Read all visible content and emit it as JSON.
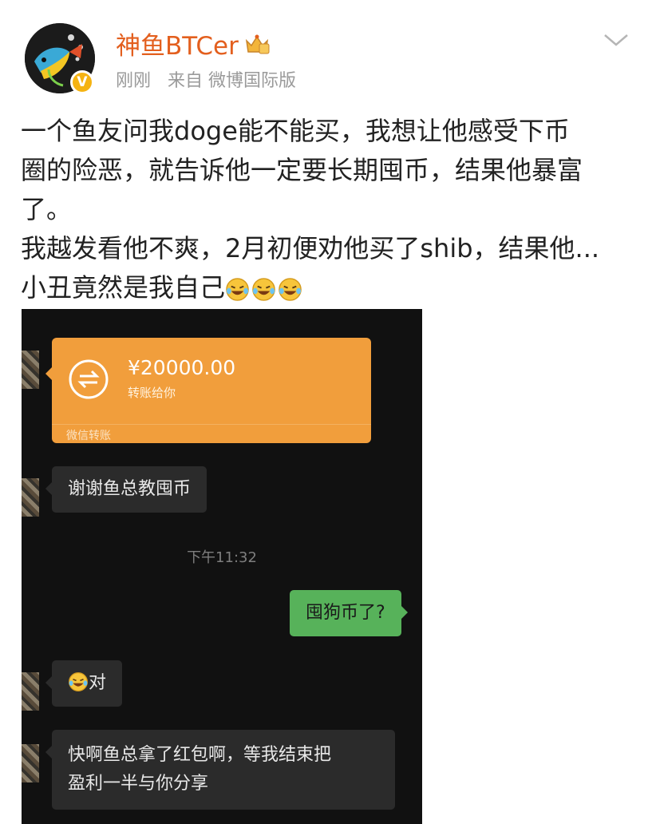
{
  "post": {
    "username": "神鱼BTCer",
    "time": "刚刚",
    "source": "来自 微博国际版",
    "text_lines": [
      "一个鱼友问我doge能不能买，我想让他感受下币",
      "圈的险恶，就告诉他一定要长期囤币，结果他暴富",
      "了。",
      "我越发看他不爽，2月初便劝他买了shib，结果他...",
      "小丑竟然是我自己"
    ]
  },
  "icons": {
    "avatar": "fish-avatar-icon",
    "verified": "verified-badge-icon",
    "crown": "crown-badge-icon",
    "more": "chevron-down-icon",
    "emoji": "laughing-crying-emoji-icon",
    "transfer": "transfer-arrows-icon"
  },
  "colors": {
    "username": "#e35f1e",
    "transfer_card": "#f19e3c",
    "sent_bubble": "#57b25a",
    "chat_bg": "#111111"
  },
  "chat": {
    "transfer": {
      "amount": "¥20000.00",
      "subtitle": "转账给你",
      "footer": "微信转账"
    },
    "messages": [
      {
        "side": "left",
        "text": "谢谢鱼总教囤币"
      },
      {
        "side": "right",
        "text": "囤狗币了?"
      },
      {
        "side": "left",
        "text": "对"
      },
      {
        "side": "left",
        "text_lines": [
          "快啊鱼总拿了红包啊，等我结束把",
          "盈利一半与你分享"
        ]
      }
    ],
    "timestamp": "下午11:32"
  }
}
